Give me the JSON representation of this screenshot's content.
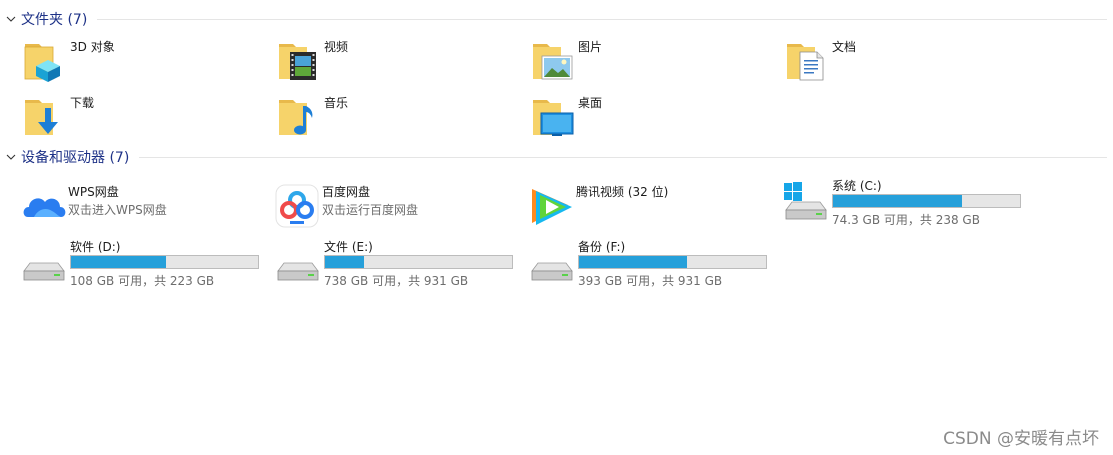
{
  "folders_group": {
    "title": "文件夹 (7)"
  },
  "folders": [
    {
      "name": "3D 对象",
      "icon": "3d-objects-folder-icon"
    },
    {
      "name": "视频",
      "icon": "videos-folder-icon"
    },
    {
      "name": "图片",
      "icon": "pictures-folder-icon"
    },
    {
      "name": "文档",
      "icon": "documents-folder-icon"
    },
    {
      "name": "下载",
      "icon": "downloads-folder-icon"
    },
    {
      "name": "音乐",
      "icon": "music-folder-icon"
    },
    {
      "name": "桌面",
      "icon": "desktop-folder-icon"
    }
  ],
  "devices_group": {
    "title": "设备和驱动器 (7)"
  },
  "apps": [
    {
      "name": "WPS网盘",
      "sub": "双击进入WPS网盘",
      "icon": "wps-cloud-icon"
    },
    {
      "name": "百度网盘",
      "sub": "双击运行百度网盘",
      "icon": "baidu-netdisk-icon"
    },
    {
      "name": "腾讯视频 (32 位)",
      "icon": "tencent-video-icon"
    }
  ],
  "drives": [
    {
      "name": "系统 (C:)",
      "free": "74.3 GB 可用，共 238 GB",
      "used_fraction": 0.69
    },
    {
      "name": "软件 (D:)",
      "free": "108 GB 可用，共 223 GB",
      "used_fraction": 0.51
    },
    {
      "name": "文件 (E:)",
      "free": "738 GB 可用，共 931 GB",
      "used_fraction": 0.21
    },
    {
      "name": "备份 (F:)",
      "free": "393 GB 可用，共 931 GB",
      "used_fraction": 0.58
    }
  ],
  "colors": {
    "accent": "#26a0da",
    "header": "#1e3287"
  },
  "watermark": "CSDN @安暖有点坏"
}
